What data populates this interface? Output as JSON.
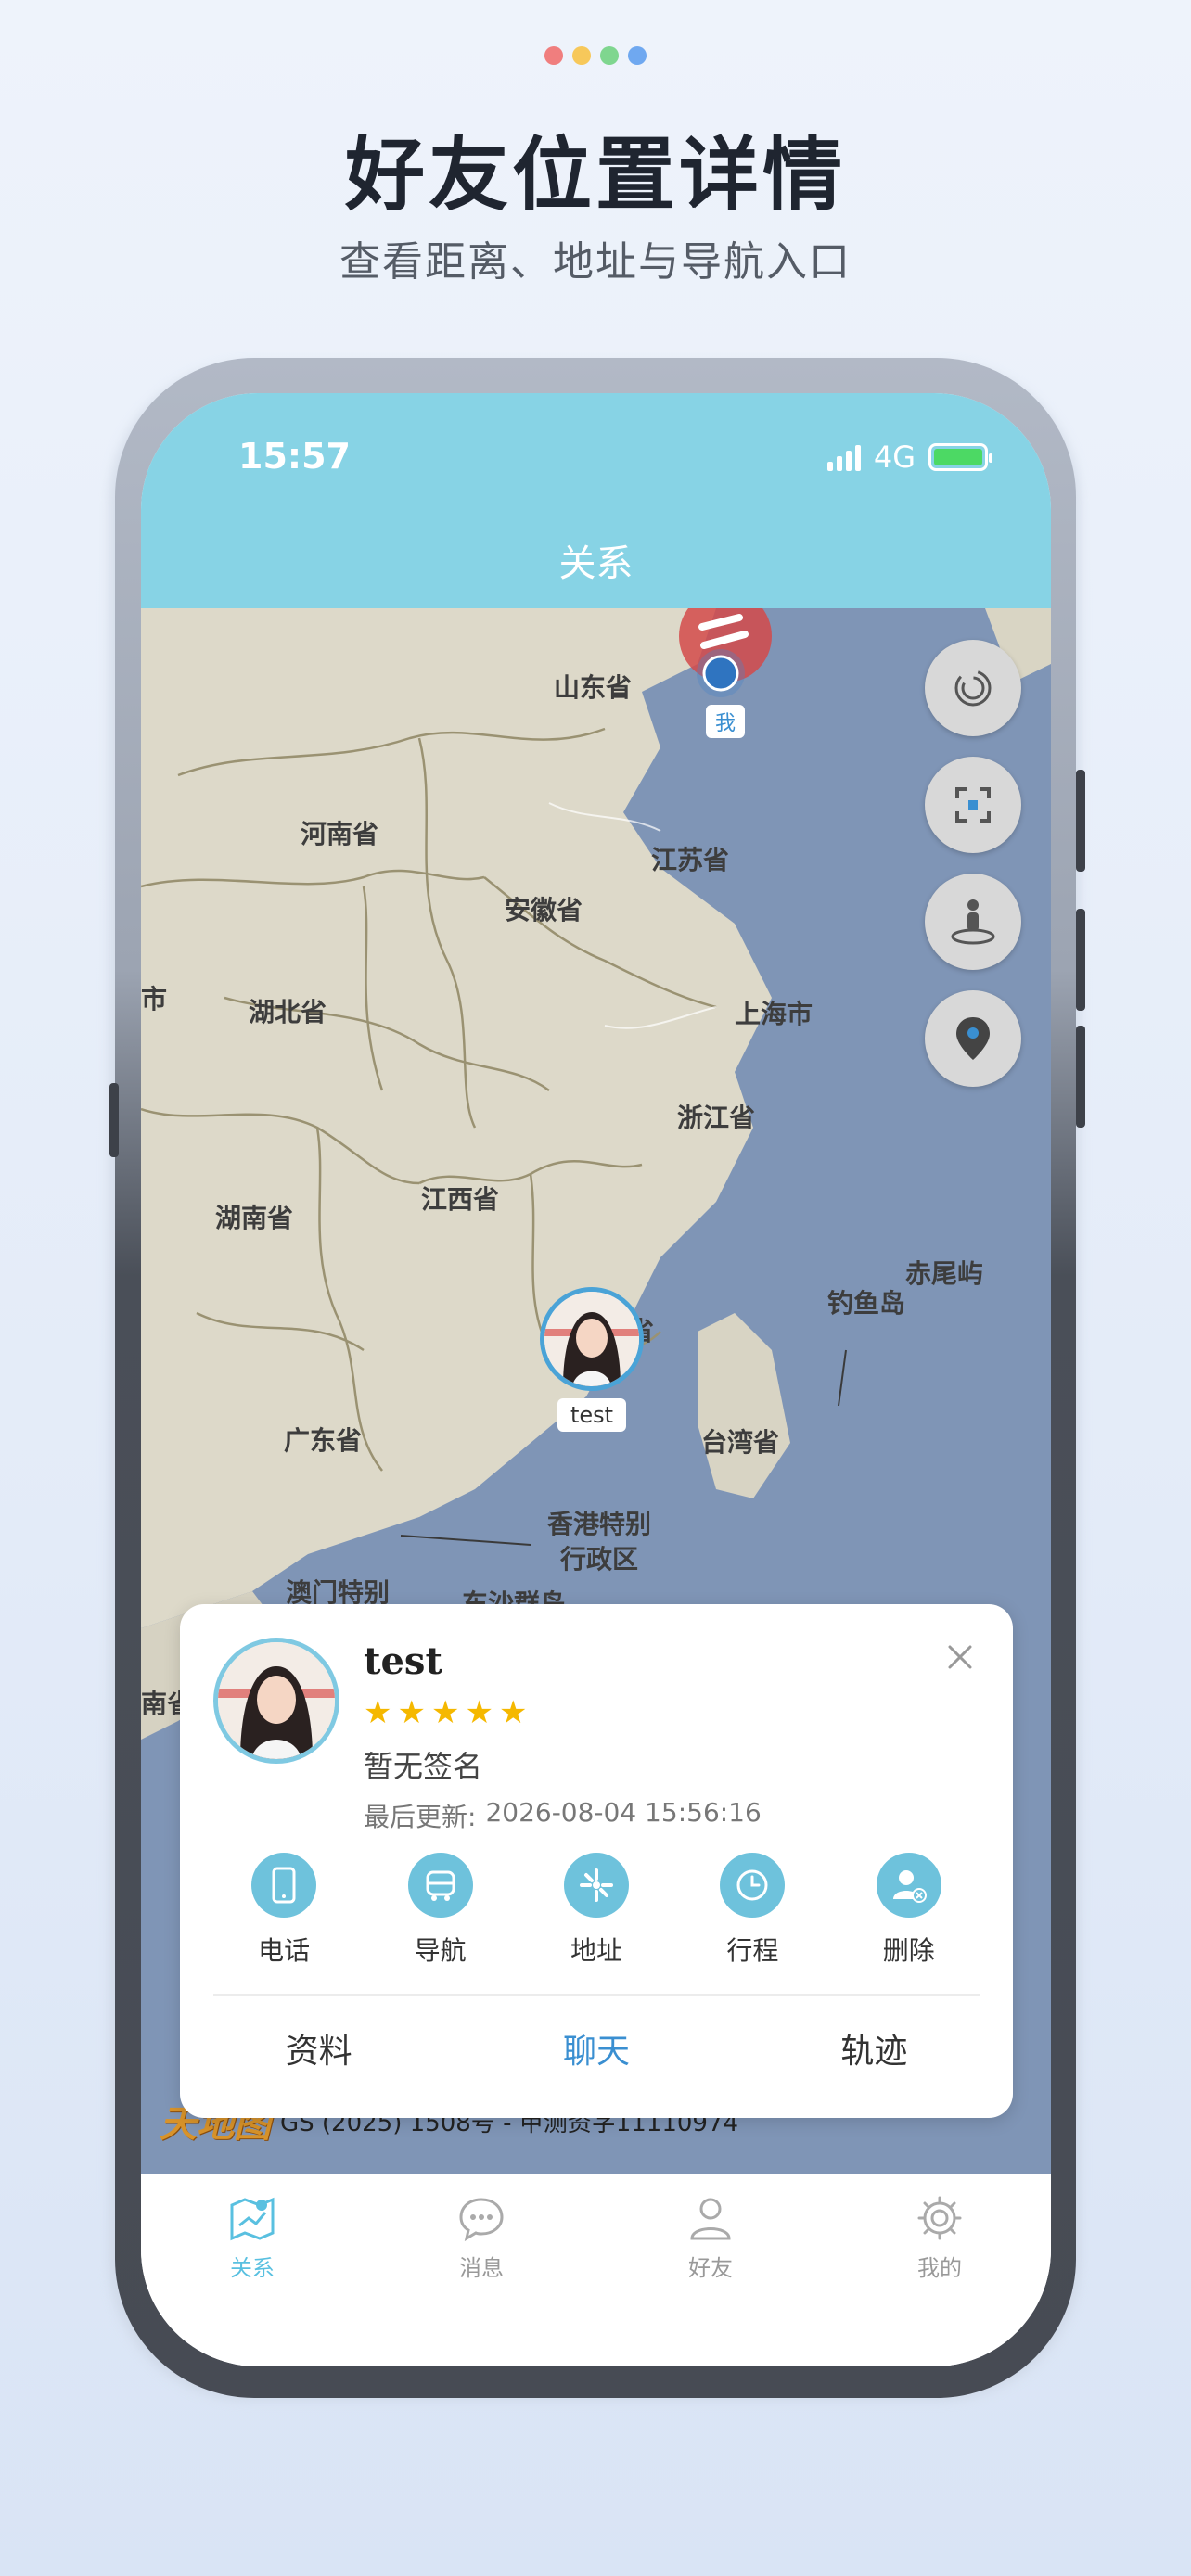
{
  "header": {
    "title": "好友位置详情",
    "subtitle": "查看距离、地址与导航入口",
    "dot_colors": [
      "#f07e7e",
      "#f7c85a",
      "#7fd68f",
      "#6fa8f0"
    ]
  },
  "status_bar": {
    "time": "15:57",
    "network": "4G"
  },
  "nav": {
    "title": "关系"
  },
  "map": {
    "provinces": [
      {
        "id": "shandong",
        "label": "山东省"
      },
      {
        "id": "henan",
        "label": "河南省"
      },
      {
        "id": "jiangsu",
        "label": "江苏省"
      },
      {
        "id": "anhui",
        "label": "安徽省"
      },
      {
        "id": "hubei",
        "label": "湖北省"
      },
      {
        "id": "shanghai",
        "label": "上海市"
      },
      {
        "id": "zhejiang",
        "label": "浙江省"
      },
      {
        "id": "hunan",
        "label": "湖南省"
      },
      {
        "id": "jiangxi",
        "label": "江西省"
      },
      {
        "id": "chiweiyu",
        "label": "赤尾屿"
      },
      {
        "id": "diaoyudao",
        "label": "钓鱼岛"
      },
      {
        "id": "guangdong",
        "label": "广东省"
      },
      {
        "id": "taiwan",
        "label": "台湾省"
      },
      {
        "id": "hongkong1",
        "label": "香港特别"
      },
      {
        "id": "hongkong2",
        "label": "行政区"
      },
      {
        "id": "macao",
        "label": "澳门特别"
      },
      {
        "id": "dongsha",
        "label": "东沙群岛"
      },
      {
        "id": "hainan_edge",
        "label": "南省"
      },
      {
        "id": "left_edge",
        "label": "市"
      },
      {
        "id": "fujian_partial",
        "label": "省"
      }
    ],
    "me_label": "我",
    "friend_label": "test",
    "attribution_logo": "天地图",
    "attribution_text": "GS (2025) 1508号 - 甲测资字11110974",
    "tools": [
      "refresh-icon",
      "focus-icon",
      "person-pin-icon",
      "location-icon"
    ]
  },
  "card": {
    "name": "test",
    "rating": 5,
    "signature": "暂无签名",
    "last_update_label": "最后更新:",
    "last_update_value": "2026-08-04 15:56:16",
    "actions": [
      {
        "label": "电话",
        "icon": "phone-icon"
      },
      {
        "label": "导航",
        "icon": "navigation-icon"
      },
      {
        "label": "地址",
        "icon": "address-icon"
      },
      {
        "label": "行程",
        "icon": "clock-icon"
      },
      {
        "label": "删除",
        "icon": "delete-user-icon"
      }
    ],
    "bottom": {
      "profile": "资料",
      "chat": "聊天",
      "track": "轨迹"
    }
  },
  "tabbar": [
    {
      "label": "关系",
      "icon": "map-icon",
      "active": true
    },
    {
      "label": "消息",
      "icon": "chat-icon",
      "active": false
    },
    {
      "label": "好友",
      "icon": "person-icon",
      "active": false
    },
    {
      "label": "我的",
      "icon": "gear-icon",
      "active": false
    }
  ],
  "colors": {
    "accent": "#87d3e5",
    "link": "#3a8fd1",
    "star": "#f5b800"
  }
}
